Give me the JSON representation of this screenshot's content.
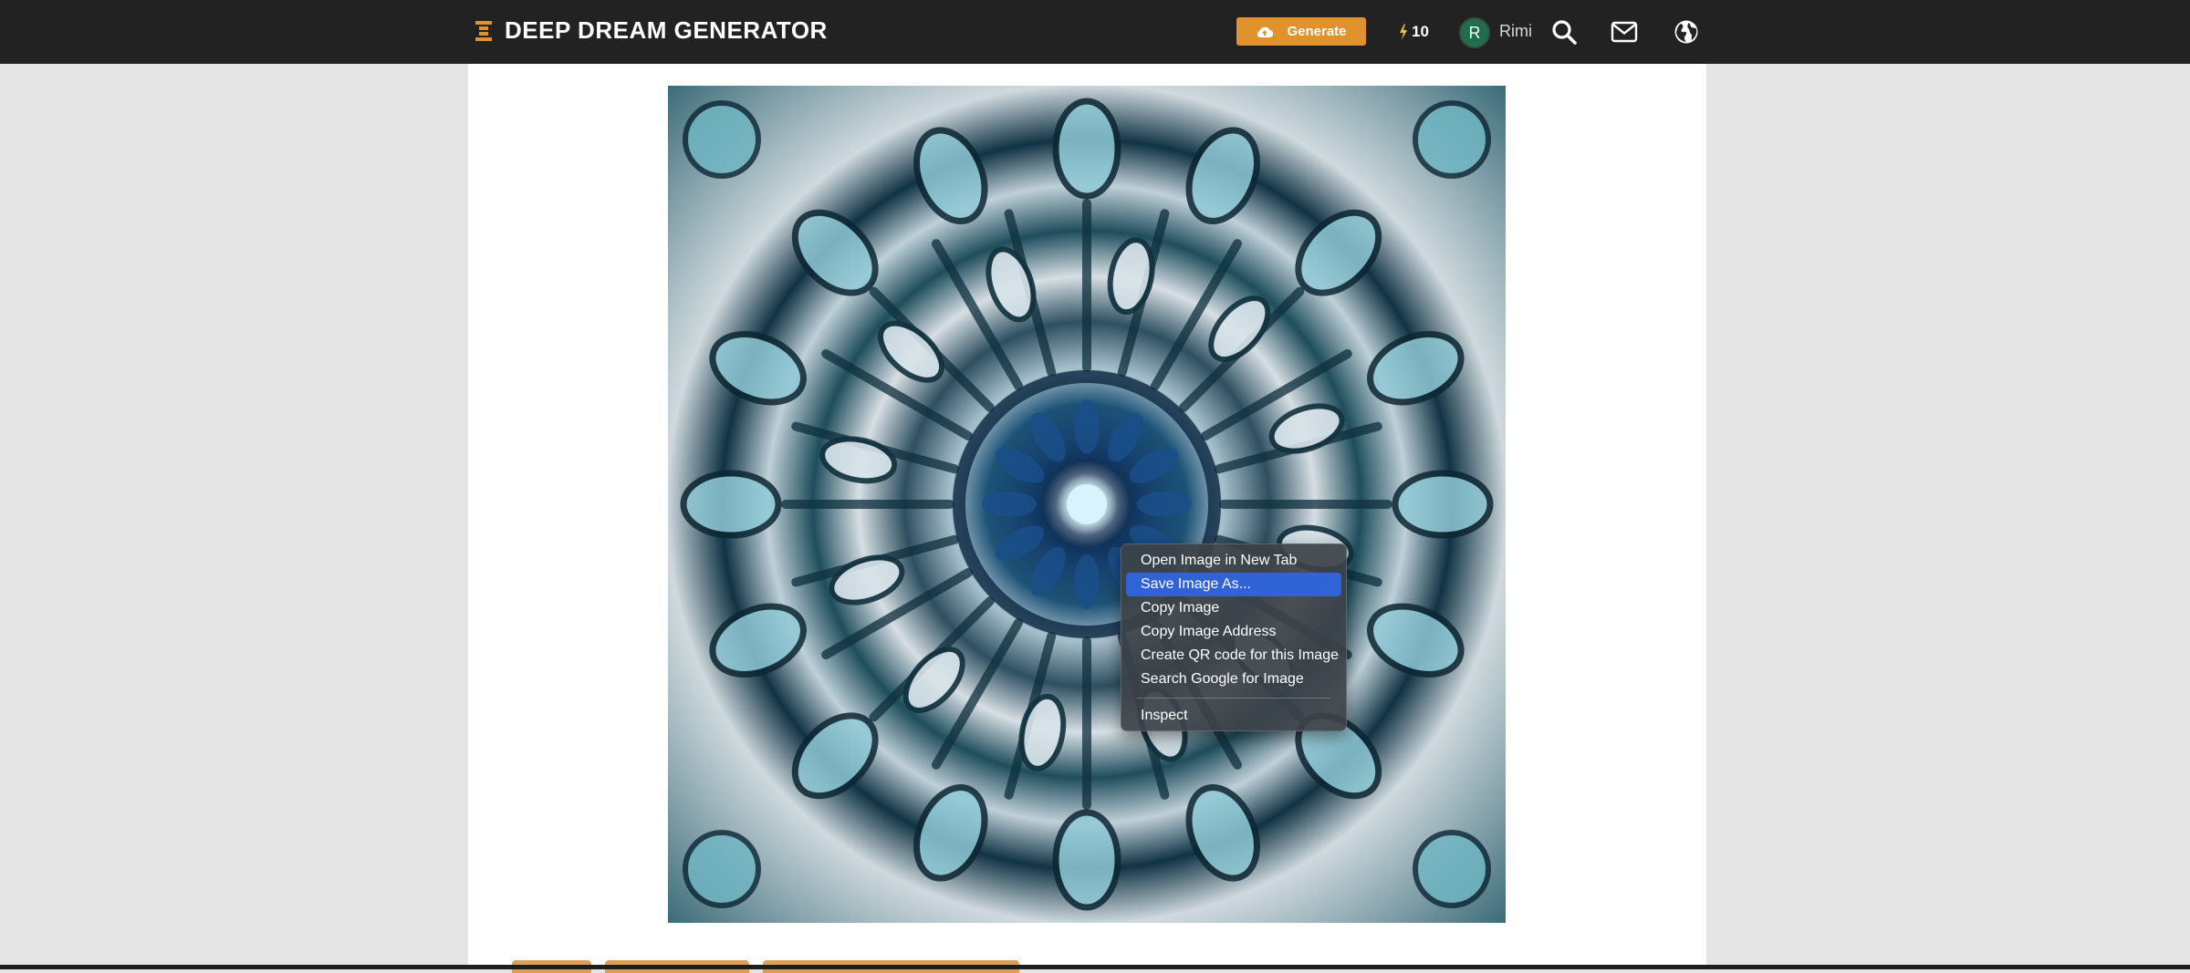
{
  "navbar": {
    "logo_text": "DEEP DREAM GENERATOR",
    "generate_label": "Generate",
    "energy_count": "10",
    "avatar_initial": "R",
    "username": "Rimi"
  },
  "colors": {
    "navbar_bg": "#222222",
    "accent": "#e0922c",
    "avatar_bg": "#1f6f4d",
    "menu_highlight": "#2f63d6",
    "page_bg": "#e5e5e5"
  },
  "icons": [
    "menu-icon",
    "cloud-upload-icon",
    "lightning-icon",
    "search-icon",
    "mail-icon",
    "globe-icon"
  ],
  "context_menu": {
    "items": [
      {
        "label": "Open Image in New Tab",
        "highlighted": false
      },
      {
        "label": "Save Image As...",
        "highlighted": true
      },
      {
        "label": "Copy Image",
        "highlighted": false
      },
      {
        "label": "Copy Image Address",
        "highlighted": false
      },
      {
        "label": "Create QR code for this Image",
        "highlighted": false
      },
      {
        "label": "Search Google for Image",
        "highlighted": false
      }
    ],
    "footer_item": "Inspect"
  }
}
